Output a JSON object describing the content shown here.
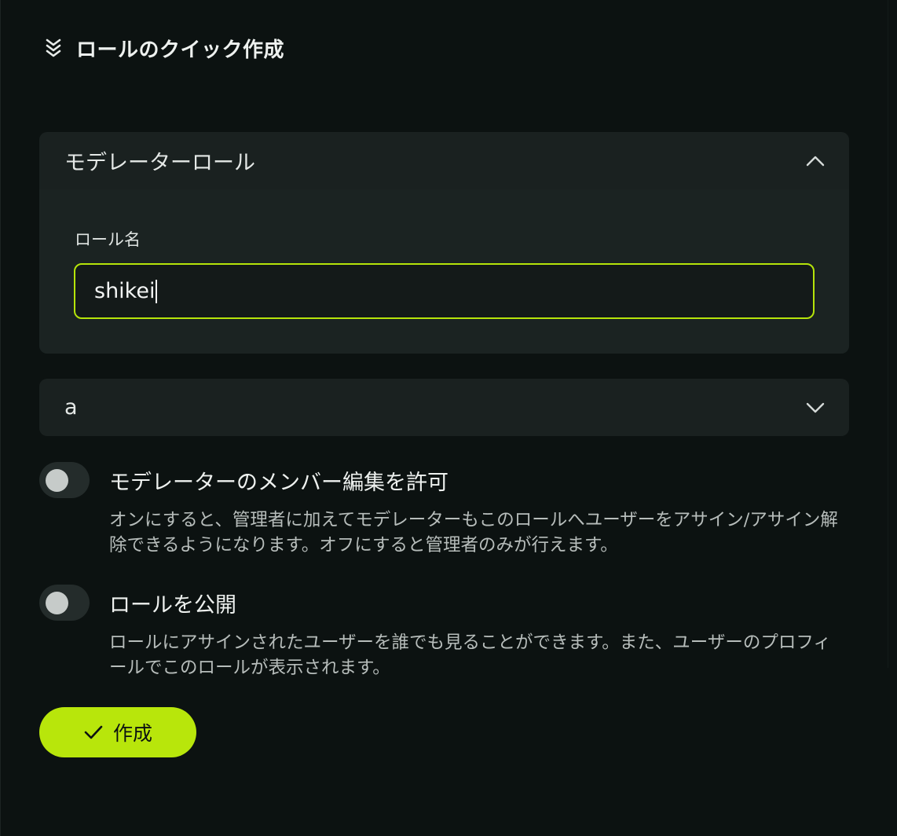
{
  "header": {
    "title": "ロールのクイック作成",
    "icon": "chevrons-down-icon"
  },
  "accordion_moderator": {
    "title": "モデレーターロール",
    "expanded": true,
    "role_name_label": "ロール名",
    "role_name_value": "shikei"
  },
  "accordion_a": {
    "title": "a",
    "expanded": false
  },
  "toggle_member_edit": {
    "title": "モデレーターのメンバー編集を許可",
    "description": "オンにすると、管理者に加えてモデレーターもこのロールへユーザーをアサイン/アサイン解除できるようになります。オフにすると管理者のみが行えます。",
    "on": false
  },
  "toggle_public": {
    "title": "ロールを公開",
    "description": "ロールにアサインされたユーザーを誰でも見ることができます。また、ユーザーのプロフィールでこのロールが表示されます。",
    "on": false
  },
  "create_button": {
    "label": "作成",
    "icon": "check-icon"
  },
  "colors": {
    "accent": "#b8e60b",
    "background": "#0c1211",
    "card": "#1a2120"
  }
}
